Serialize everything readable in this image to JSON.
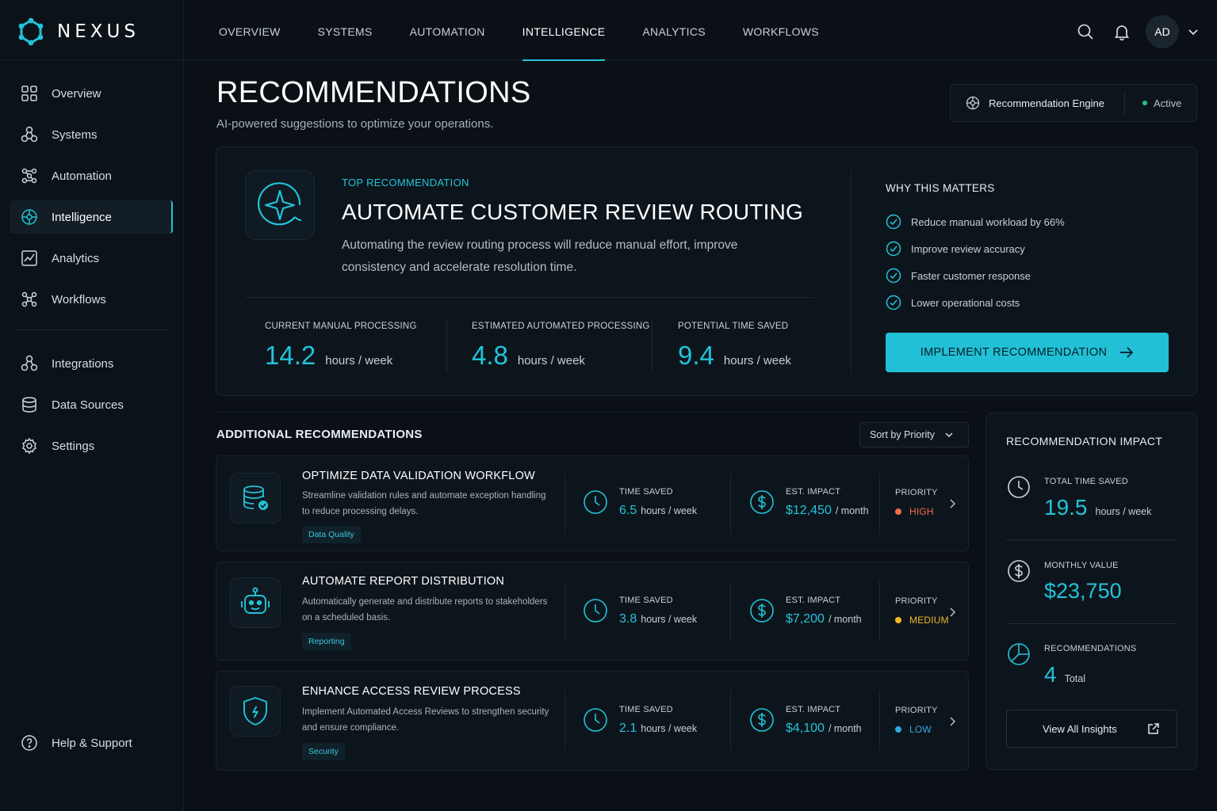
{
  "app": {
    "name": "NEXUS"
  },
  "colors": {
    "accent": "#22c3d8",
    "high": "#f26a4b",
    "medium": "#f1b72b",
    "low": "#2fa8e0",
    "active": "#26c281"
  },
  "sidebar": {
    "items": [
      {
        "label": "Overview",
        "icon": "grid-icon"
      },
      {
        "label": "Systems",
        "icon": "nodes-icon"
      },
      {
        "label": "Automation",
        "icon": "flow-icon"
      },
      {
        "label": "Intelligence",
        "icon": "brain-icon",
        "active": true
      },
      {
        "label": "Analytics",
        "icon": "chart-icon"
      },
      {
        "label": "Workflows",
        "icon": "workflow-icon"
      }
    ],
    "secondary": [
      {
        "label": "Integrations",
        "icon": "integrations-icon"
      },
      {
        "label": "Data Sources",
        "icon": "database-icon"
      },
      {
        "label": "Settings",
        "icon": "gear-icon"
      }
    ],
    "help": {
      "label": "Help & Support",
      "icon": "help-icon"
    }
  },
  "topnav": {
    "tabs": [
      "OVERVIEW",
      "SYSTEMS",
      "AUTOMATION",
      "INTELLIGENCE",
      "ANALYTICS",
      "WORKFLOWS"
    ],
    "active_tab": "INTELLIGENCE",
    "avatar": "AD"
  },
  "header": {
    "title": "RECOMMENDATIONS",
    "subtitle": "AI-powered suggestions to optimize your operations.",
    "engine_label": "Recommendation Engine",
    "engine_status": "Active"
  },
  "top": {
    "label": "TOP RECOMMENDATION",
    "title": "AUTOMATE CUSTOMER REVIEW ROUTING",
    "description": "Automating the review routing process will reduce manual effort, improve consistency and accelerate resolution time.",
    "metrics": [
      {
        "label": "CURRENT MANUAL PROCESSING",
        "value": "14.2",
        "unit": "hours / week"
      },
      {
        "label": "ESTIMATED AUTOMATED PROCESSING",
        "value": "4.8",
        "unit": "hours / week"
      },
      {
        "label": "POTENTIAL TIME SAVED",
        "value": "9.4",
        "unit": "hours / week"
      }
    ],
    "why_title": "WHY THIS MATTERS",
    "why": [
      "Reduce manual workload by 66%",
      "Improve review accuracy",
      "Faster customer response",
      "Lower operational costs"
    ],
    "button": "IMPLEMENT RECOMMENDATION"
  },
  "additional": {
    "title": "ADDITIONAL RECOMMENDATIONS",
    "sort_label": "Sort by Priority",
    "time_label": "TIME SAVED",
    "impact_label": "EST. IMPACT",
    "priority_label": "PRIORITY",
    "items": [
      {
        "title": "OPTIMIZE DATA VALIDATION WORKFLOW",
        "description": "Streamline validation rules and automate exception handling to reduce processing delays.",
        "tag": "Data Quality",
        "time_value": "6.5",
        "time_unit": "hours / week",
        "impact_value": "$12,450",
        "impact_unit": "/ month",
        "priority": "HIGH",
        "icon": "database-check-icon"
      },
      {
        "title": "AUTOMATE REPORT DISTRIBUTION",
        "description": "Automatically generate and distribute reports to stakeholders on a scheduled basis.",
        "tag": "Reporting",
        "time_value": "3.8",
        "time_unit": "hours / week",
        "impact_value": "$7,200",
        "impact_unit": "/ month",
        "priority": "MEDIUM",
        "icon": "robot-icon"
      },
      {
        "title": "ENHANCE ACCESS REVIEW PROCESS",
        "description": "Implement Automated Access Reviews to strengthen security and ensure compliance.",
        "tag": "Security",
        "time_value": "2.1",
        "time_unit": "hours / week",
        "impact_value": "$4,100",
        "impact_unit": "/ month",
        "priority": "LOW",
        "icon": "shield-icon"
      }
    ]
  },
  "impact": {
    "title": "RECOMMENDATION IMPACT",
    "total_time": {
      "label": "TOTAL TIME SAVED",
      "value": "19.5",
      "unit": "hours / week"
    },
    "monthly": {
      "label": "MONTHLY VALUE",
      "value": "$23,750"
    },
    "count": {
      "label": "RECOMMENDATIONS",
      "value": "4",
      "unit": "Total"
    },
    "button": "View All Insights"
  }
}
